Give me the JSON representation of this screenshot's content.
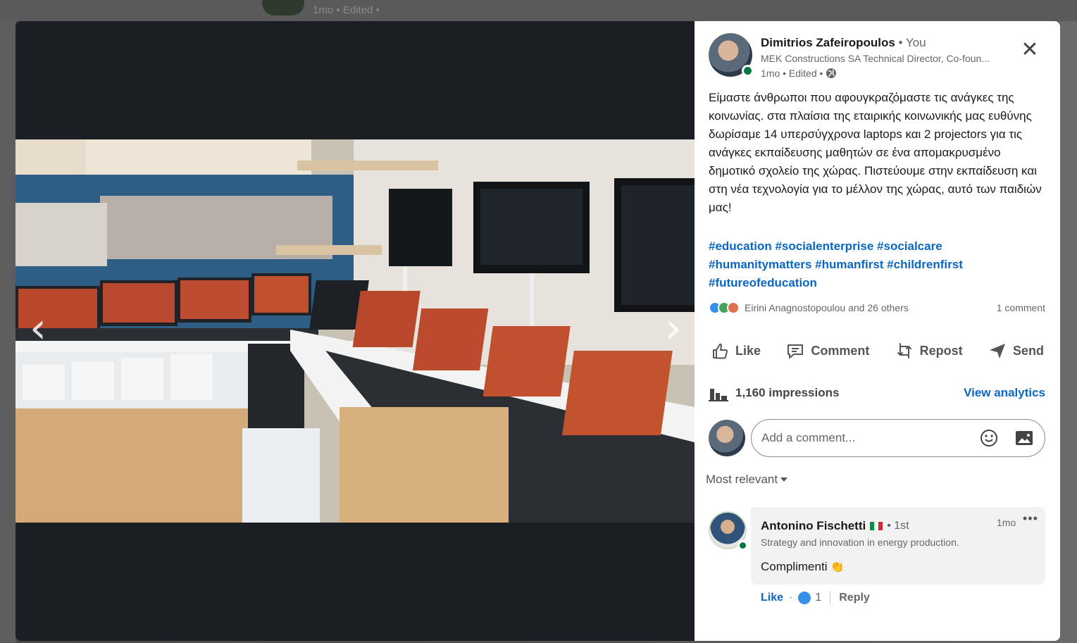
{
  "background": {
    "top_meta": "1mo • Edited • "
  },
  "media": {
    "photo_alt": "",
    "nav_prev": "‹",
    "nav_next": "›"
  },
  "post": {
    "author_name": "Dimitrios Zafeiropoulos",
    "author_you": " • You",
    "author_headline": "MEK Constructions SA Technical Director, Co-foun...",
    "meta": "1mo • Edited •",
    "close": "✕",
    "text": "Είμαστε άνθρωποι που αφουγκραζόμαστε τις ανάγκες της κοινωνίας. στα πλαίσια της εταιρικής κοινωνικής μας ευθύνης δωρίσαμε 14 υπερσύγχρονα laptops και 2 projectors για τις ανάγκες εκπαίδευσης μαθητών σε ένα απομακρυσμένο δημοτικό σχολείο της χώρας. Πιστεύουμε στην εκπαίδευση και στη νέα τεχνολογία για το μέλλον της χώρας, αυτό των παιδιών μας!",
    "hashtags": "#education #socialenterprise #socialcare #humanitymatters #humanfirst #childrenfirst #futureofeducation",
    "reactions_text": "Eirini Anagnostopoulou and 26 others",
    "comment_count": "1 comment",
    "actions": {
      "like": "Like",
      "comment": "Comment",
      "repost": "Repost",
      "send": "Send"
    },
    "impressions": "1,160 impressions",
    "view_analytics": "View analytics",
    "comment_placeholder": "Add a comment...",
    "sort_label": "Most relevant"
  },
  "comment": {
    "name": "Antonino Fischetti",
    "degree": "• 1st",
    "time": "1mo",
    "more": "•••",
    "headline": "Strategy and innovation in energy production.",
    "text": "Complimenti",
    "emoji": "👏",
    "like": "Like",
    "dot": "·",
    "reaction_count": "1",
    "reply": "Reply"
  },
  "colors": {
    "link": "#0a66c2",
    "online": "#057642",
    "like_reaction": "#378fe9"
  }
}
